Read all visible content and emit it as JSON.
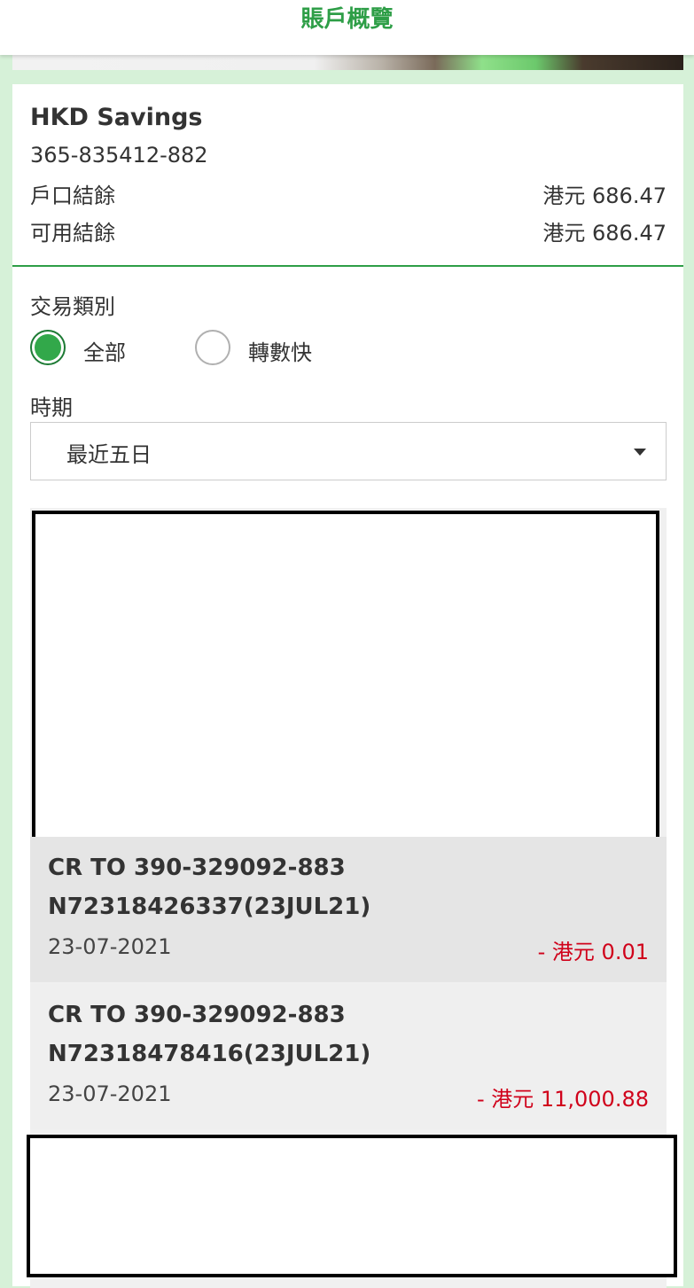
{
  "header": {
    "title": "賬戶概覽"
  },
  "account": {
    "name": "HKD Savings",
    "number": "365-835412-882",
    "ledger_balance_label": "戶口結餘",
    "ledger_balance_value": "港元 686.47",
    "available_balance_label": "可用結餘",
    "available_balance_value": "港元 686.47"
  },
  "filters": {
    "type_label": "交易類別",
    "options": [
      {
        "label": "全部",
        "selected": true
      },
      {
        "label": "轉數快",
        "selected": false
      }
    ],
    "period_label": "時期",
    "period_value": "最近五日"
  },
  "transactions": [
    {
      "desc_line1": "CR TO 390-329092-883",
      "desc_line2": "N72318426337(23JUL21)",
      "date": "23-07-2021",
      "amount": "- 港元 0.01"
    },
    {
      "desc_line1": "CR TO 390-329092-883",
      "desc_line2": "N72318478416(23JUL21)",
      "date": "23-07-2021",
      "amount": "- 港元 11,000.88"
    }
  ],
  "colors": {
    "brand_green": "#2e9e47",
    "background_mint": "#d6f1d8",
    "debit_red": "#d0021b"
  }
}
